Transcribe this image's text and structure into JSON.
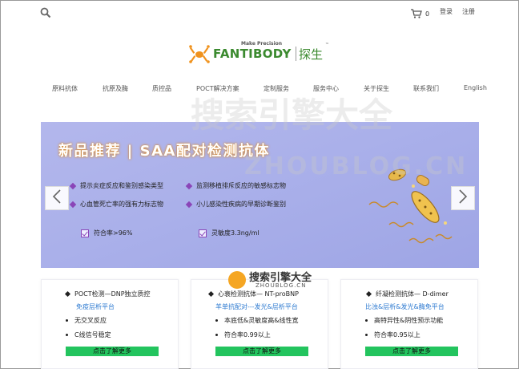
{
  "header": {
    "cart_count": "0",
    "login_label": "登录",
    "register_label": "注册"
  },
  "logo": {
    "tagline": "Make Precision",
    "wordmark": "FANTIBODY",
    "chinese": "探生",
    "tm": "™"
  },
  "nav": {
    "items": [
      {
        "label": "原料抗体"
      },
      {
        "label": "抗原及酶"
      },
      {
        "label": "质控品"
      },
      {
        "label": "POCT解决方案"
      },
      {
        "label": "定制服务"
      },
      {
        "label": "服务中心"
      },
      {
        "label": "关于探生"
      },
      {
        "label": "联系我们"
      },
      {
        "label": "English"
      }
    ]
  },
  "watermark": {
    "cn": "搜索引擎大全",
    "en": "ZHOUBLOG.CN"
  },
  "banner": {
    "title": "新品推荐 | SAA配对检测抗体",
    "features_left": [
      "提示炎症反应和鉴别感染类型",
      "心血管死亡率的强有力标志物"
    ],
    "features_right": [
      "监测移植排斥反应的敏感标志物",
      "小儿感染性疾病的早期诊断鉴别"
    ],
    "spec_left": "符合率>96%",
    "spec_right": "灵敏度3.3ng/ml"
  },
  "cards": [
    {
      "title": "POCT检测—DNP独立质控",
      "subtitle": "免疫层析平台",
      "items": [
        "无交叉反应",
        "C线信号稳定"
      ],
      "button": "点击了解更多"
    },
    {
      "title": "心衰检测抗体— NT-proBNP",
      "subtitle": "羊单抗配对---发光&层析平台",
      "items": [
        "本底低&灵敏度高&线性宽",
        "符合率0.99以上"
      ],
      "button": "点击了解更多"
    },
    {
      "title": "纤凝检测抗体— D-dimer",
      "subtitle": "比浊&层析&发光&酶免平台",
      "items": [
        "高特异性&阴性预示功能",
        "符合率0.95以上"
      ],
      "button": "点击了解更多"
    }
  ],
  "center_watermark": {
    "cn": "搜索引擎大全",
    "en": "ZHOUBLOG.CN"
  },
  "colors": {
    "brand_green": "#3b8a2f",
    "logo_orange": "#f0921d",
    "button_green": "#23c45e",
    "link_blue": "#2f7bd1",
    "accent_purple": "#8a45b8"
  },
  "icons": {
    "search": "search-icon",
    "cart": "cart-icon",
    "prev": "chevron-left-icon",
    "next": "chevron-right-icon"
  }
}
